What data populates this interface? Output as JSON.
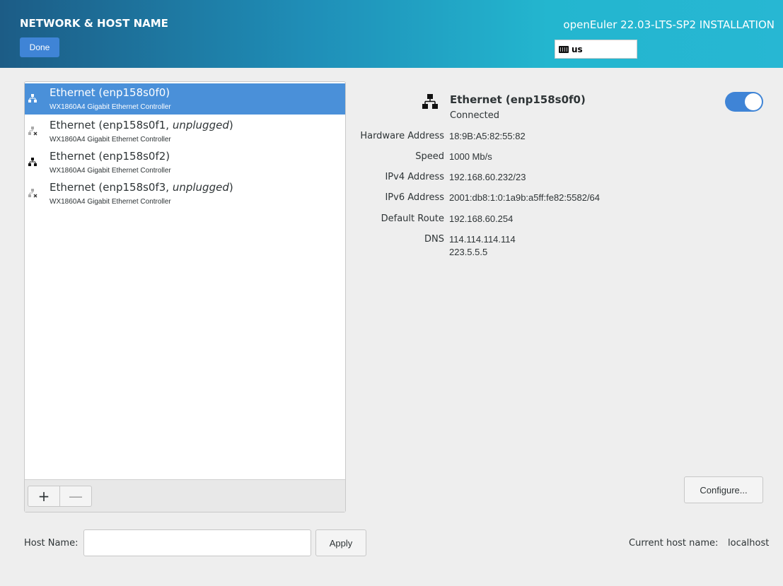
{
  "header": {
    "title": "NETWORK & HOST NAME",
    "done_label": "Done",
    "product": "openEuler 22.03-LTS-SP2 INSTALLATION",
    "keyboard_layout": "us"
  },
  "devices": [
    {
      "name": "Ethernet (enp158s0f0)",
      "suffix": "",
      "description": "WX1860A4 Gigabit Ethernet Controller",
      "selected": true,
      "plugged": true
    },
    {
      "name": "Ethernet (enp158s0f1, ",
      "suffix": "unplugged",
      "close": ")",
      "description": "WX1860A4 Gigabit Ethernet Controller",
      "selected": false,
      "plugged": false
    },
    {
      "name": "Ethernet (enp158s0f2)",
      "suffix": "",
      "description": "WX1860A4 Gigabit Ethernet Controller",
      "selected": false,
      "plugged": true
    },
    {
      "name": "Ethernet (enp158s0f3, ",
      "suffix": "unplugged",
      "close": ")",
      "description": "WX1860A4 Gigabit Ethernet Controller",
      "selected": false,
      "plugged": false
    }
  ],
  "toolbar": {
    "add_label": "+",
    "remove_label": "—"
  },
  "detail": {
    "name": "Ethernet (enp158s0f0)",
    "status": "Connected",
    "enabled": true,
    "fields": [
      {
        "label": "Hardware Address",
        "value": "18:9B:A5:82:55:82"
      },
      {
        "label": "Speed",
        "value": "1000 Mb/s"
      },
      {
        "label": "IPv4 Address",
        "value": "192.168.60.232/23"
      },
      {
        "label": "IPv6 Address",
        "value": "2001:db8:1:0:1a9b:a5ff:fe82:5582/64"
      },
      {
        "label": "Default Route",
        "value": "192.168.60.254"
      },
      {
        "label": "DNS",
        "value": "114.114.114.114",
        "value2": "223.5.5.5"
      }
    ],
    "configure_label": "Configure..."
  },
  "host": {
    "label": "Host Name:",
    "value": "",
    "apply_label": "Apply",
    "current_label": "Current host name:",
    "current_value": "localhost"
  },
  "colors": {
    "accent": "#3f84d6",
    "selection": "#4a90d9"
  }
}
